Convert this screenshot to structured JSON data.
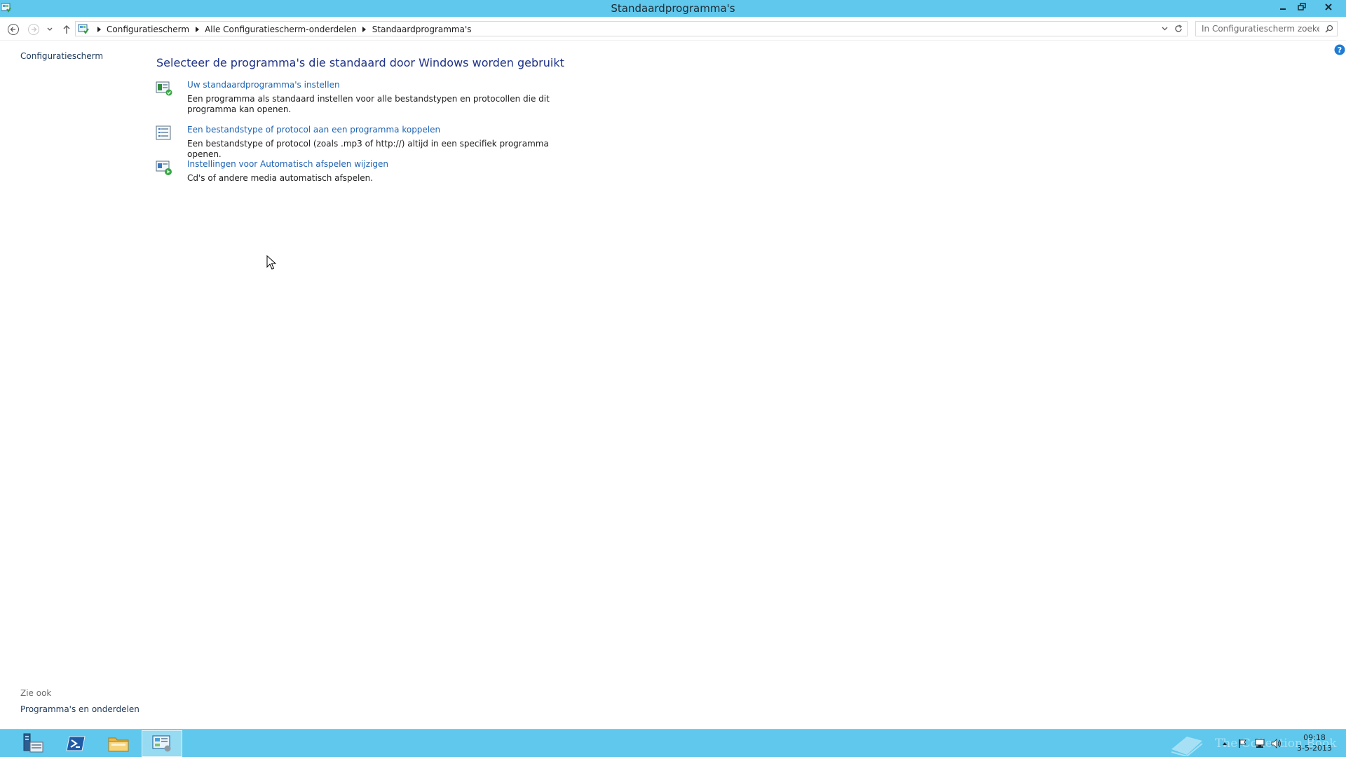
{
  "window": {
    "title": "Standaardprogramma's"
  },
  "address_bar": {
    "breadcrumbs": [
      "Configuratiescherm",
      "Alle Configuratiescherm-onderdelen",
      "Standaardprogramma's"
    ]
  },
  "search": {
    "placeholder": "In Configuratiescherm zoeken"
  },
  "left_pane": {
    "home_link": "Configuratiescherm",
    "see_also_label": "Zie ook",
    "see_also_links": [
      "Programma's en onderdelen"
    ]
  },
  "main": {
    "heading": "Selecteer de programma's die standaard door Windows worden gebruikt",
    "tasks": [
      {
        "link": "Uw standaardprogramma's instellen",
        "description": "Een programma als standaard instellen voor alle bestandstypen en protocollen die dit programma kan openen.",
        "icon": "default-programs-icon"
      },
      {
        "link": "Een bestandstype of protocol aan een programma koppelen",
        "description": "Een bestandstype of protocol (zoals .mp3 of http://) altijd in een specifiek programma openen.",
        "icon": "file-association-icon"
      },
      {
        "link": "Instellingen voor Automatisch afspelen wijzigen",
        "description": "Cd's of andere media automatisch afspelen.",
        "icon": "autoplay-icon"
      }
    ]
  },
  "taskbar": {
    "buttons": [
      "server-manager-icon",
      "powershell-icon",
      "file-explorer-icon",
      "control-panel-icon"
    ],
    "active_index": 3,
    "watermark_text": "The Collection Book",
    "clock_time": "09:18",
    "clock_date": "3-5-2013"
  },
  "colors": {
    "titlebar": "#5fc8ec",
    "link": "#1e64b4",
    "heading": "#1e3287"
  }
}
